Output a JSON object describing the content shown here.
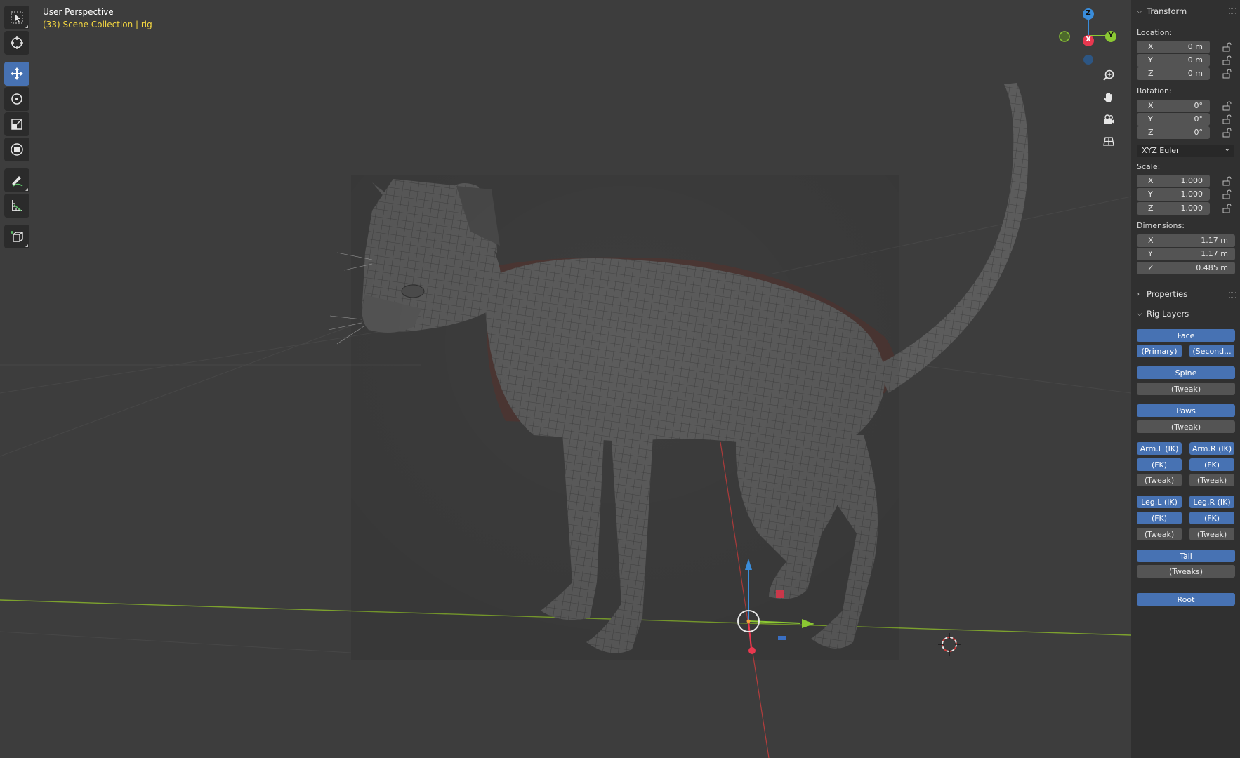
{
  "viewport": {
    "title": "User Perspective",
    "collection_info": "(33) Scene Collection | rig"
  },
  "toolbar": {
    "tools": [
      {
        "name": "select-box-tool",
        "active": false
      },
      {
        "name": "cursor-tool",
        "active": false
      },
      {
        "name": "move-tool",
        "active": true
      },
      {
        "name": "rotate-tool",
        "active": false
      },
      {
        "name": "scale-tool",
        "active": false
      },
      {
        "name": "transform-tool",
        "active": false
      },
      {
        "name": "annotate-tool",
        "active": false
      },
      {
        "name": "measure-tool",
        "active": false
      },
      {
        "name": "add-cube-tool",
        "active": false
      }
    ]
  },
  "nav_gizmo": {
    "z": "Z",
    "x": "X",
    "y": "Y",
    "colors": {
      "x": "#e8384f",
      "y": "#8bc833",
      "z": "#3a8ddb"
    }
  },
  "nav_buttons": [
    "zoom-icon",
    "pan-hand-icon",
    "camera-view-icon",
    "ortho-grid-icon"
  ],
  "transform": {
    "header": "Transform",
    "location_label": "Location:",
    "location": [
      {
        "axis": "X",
        "value": "0 m"
      },
      {
        "axis": "Y",
        "value": "0 m"
      },
      {
        "axis": "Z",
        "value": "0 m"
      }
    ],
    "rotation_label": "Rotation:",
    "rotation": [
      {
        "axis": "X",
        "value": "0°"
      },
      {
        "axis": "Y",
        "value": "0°"
      },
      {
        "axis": "Z",
        "value": "0°"
      }
    ],
    "rotation_mode": "XYZ Euler",
    "scale_label": "Scale:",
    "scale": [
      {
        "axis": "X",
        "value": "1.000"
      },
      {
        "axis": "Y",
        "value": "1.000"
      },
      {
        "axis": "Z",
        "value": "1.000"
      }
    ],
    "dimensions_label": "Dimensions:",
    "dimensions": [
      {
        "axis": "X",
        "value": "1.17 m"
      },
      {
        "axis": "Y",
        "value": "1.17 m"
      },
      {
        "axis": "Z",
        "value": "0.485 m"
      }
    ]
  },
  "properties": {
    "header": "Properties"
  },
  "rig_layers": {
    "header": "Rig Layers",
    "face": "Face",
    "primary": "(Primary)",
    "secondary": "(Second...",
    "spine": "Spine",
    "spine_tweak": "(Tweak)",
    "paws": "Paws",
    "paws_tweak": "(Tweak)",
    "arm_l_ik": "Arm.L (IK)",
    "arm_r_ik": "Arm.R (IK)",
    "arm_l_fk": "(FK)",
    "arm_r_fk": "(FK)",
    "arm_l_tweak": "(Tweak)",
    "arm_r_tweak": "(Tweak)",
    "leg_l_ik": "Leg.L (IK)",
    "leg_r_ik": "Leg.R (IK)",
    "leg_l_fk": "(FK)",
    "leg_r_fk": "(FK)",
    "leg_l_tweak": "(Tweak)",
    "leg_r_tweak": "(Tweak)",
    "tail": "Tail",
    "tail_tweaks": "(Tweaks)",
    "root": "Root"
  },
  "colors": {
    "accent": "#4772b3",
    "background": "#3d3d3d",
    "panel": "#303030",
    "field": "#545454",
    "hud_collection": "#f3d641"
  }
}
